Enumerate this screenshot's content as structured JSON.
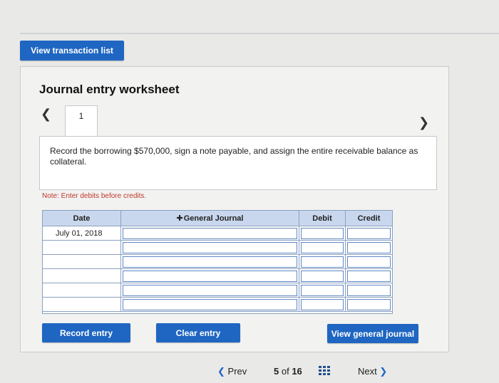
{
  "top": {
    "view_transaction_list": "View transaction list"
  },
  "worksheet": {
    "title": "Journal entry worksheet",
    "tab_number": "1",
    "description": "Record the borrowing $570,000, sign a note payable, and assign the entire receivable balance as collateral.",
    "note": "Note: Enter debits before credits."
  },
  "journal": {
    "headers": {
      "date": "Date",
      "account": "General Journal",
      "debit": "Debit",
      "credit": "Credit"
    },
    "rows": [
      {
        "date": "July 01, 2018",
        "account": "",
        "debit": "",
        "credit": ""
      },
      {
        "date": "",
        "account": "",
        "debit": "",
        "credit": ""
      },
      {
        "date": "",
        "account": "",
        "debit": "",
        "credit": ""
      },
      {
        "date": "",
        "account": "",
        "debit": "",
        "credit": ""
      },
      {
        "date": "",
        "account": "",
        "debit": "",
        "credit": ""
      },
      {
        "date": "",
        "account": "",
        "debit": "",
        "credit": ""
      }
    ]
  },
  "buttons": {
    "record_entry": "Record entry",
    "clear_entry": "Clear entry",
    "view_general_journal": "View general journal"
  },
  "pager": {
    "prev": "Prev",
    "current": "5",
    "of": "of",
    "total": "16",
    "next": "Next"
  },
  "colors": {
    "accent": "#1f66c2",
    "header_bg": "#c9d7ee",
    "note": "#c0392b"
  }
}
